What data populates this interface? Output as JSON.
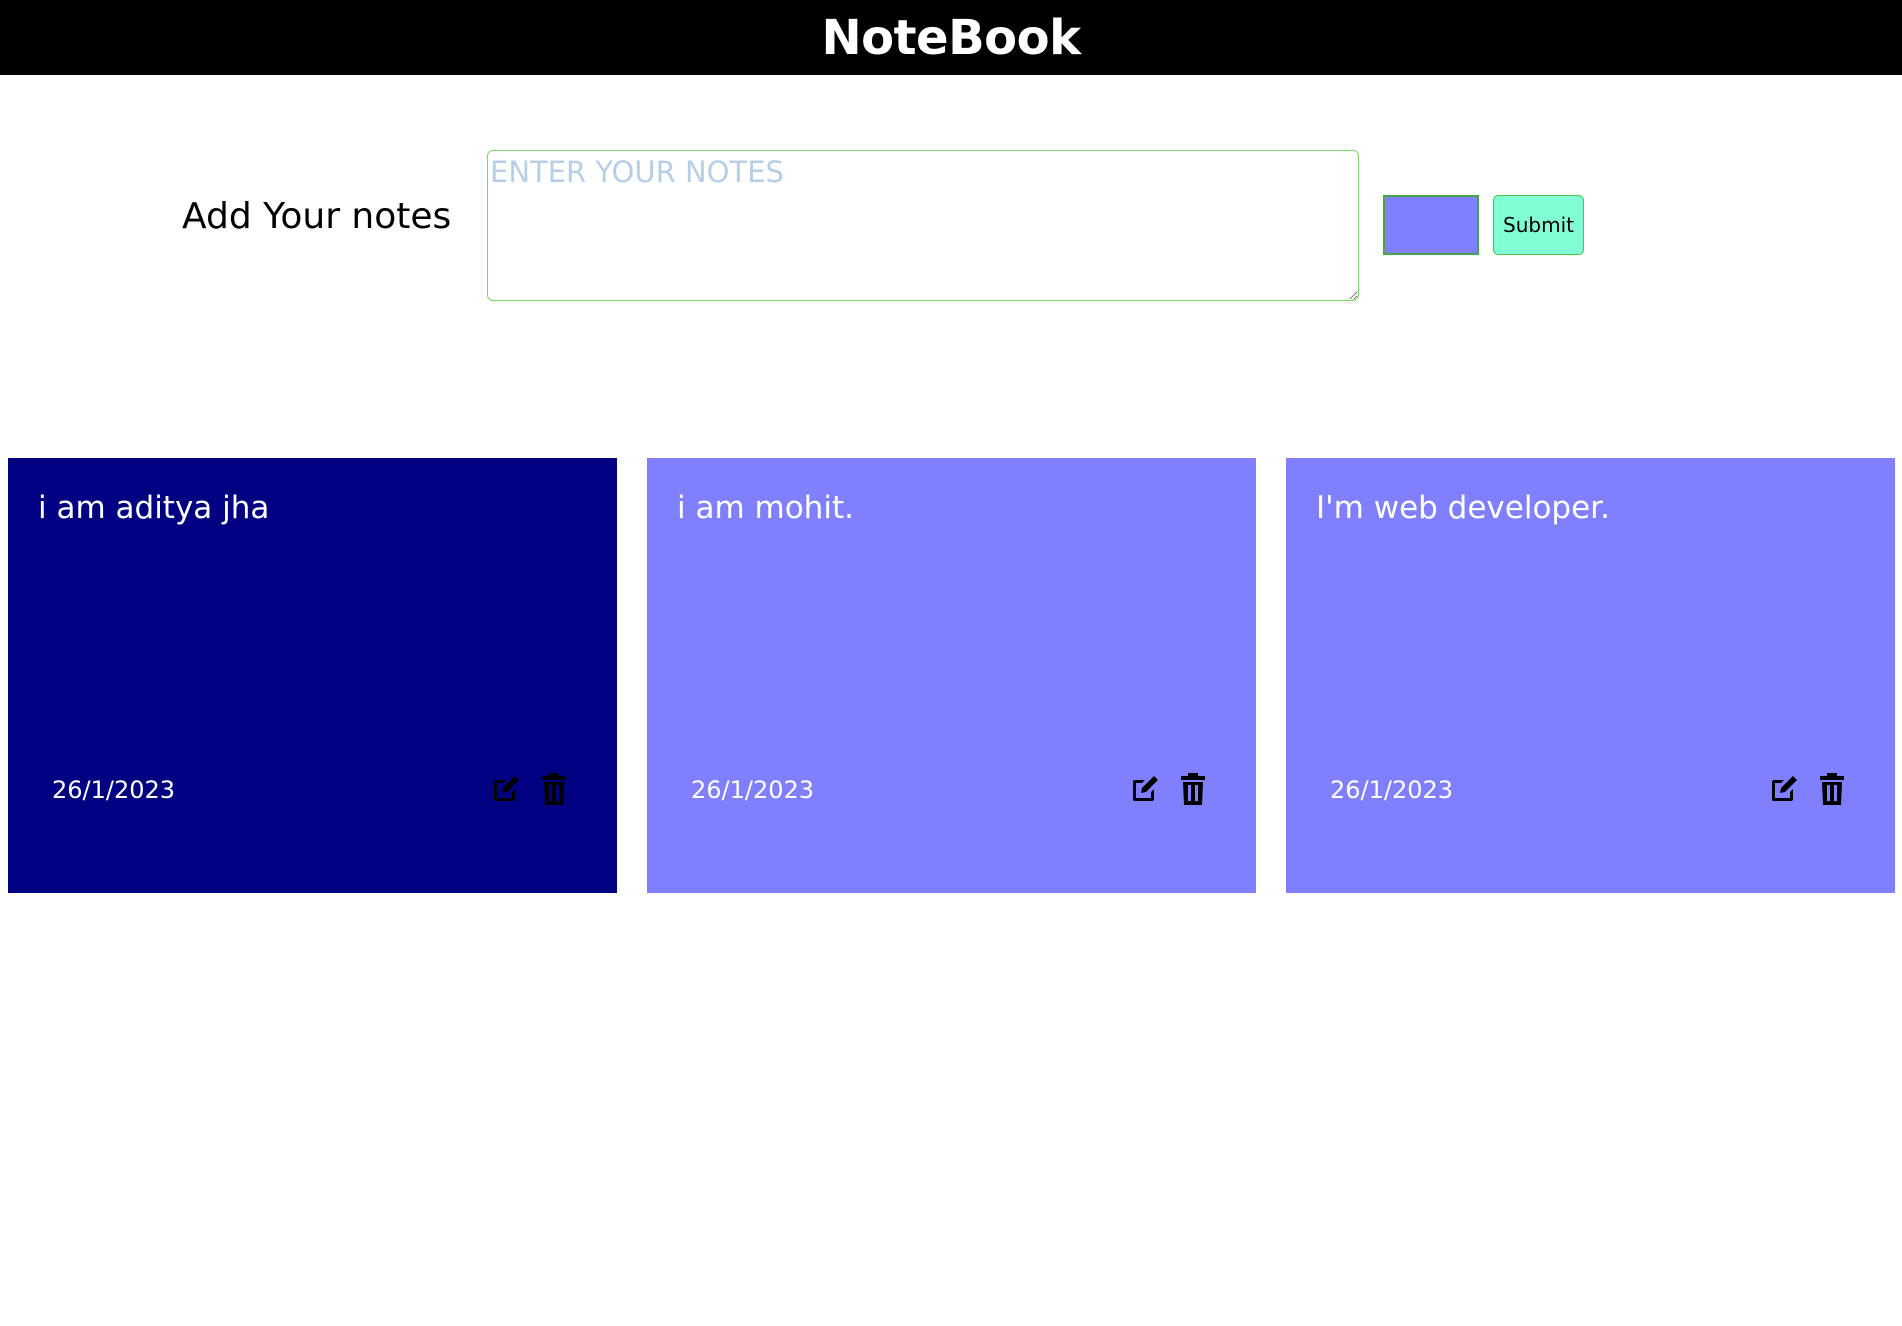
{
  "header": {
    "title": "NoteBook"
  },
  "form": {
    "label": "Add Your notes",
    "notes_placeholder": "ENTER YOUR NOTES",
    "notes_value": "",
    "selected_color": "#8080ff",
    "submit_label": "Submit"
  },
  "notes": [
    {
      "text": "i am aditya jha",
      "date": "26/1/2023",
      "color": "#000080",
      "edit_icon": "edit-icon",
      "delete_icon": "trash-icon"
    },
    {
      "text": "i am mohit.",
      "date": "26/1/2023",
      "color": "#8080ff",
      "edit_icon": "edit-icon",
      "delete_icon": "trash-icon"
    },
    {
      "text": "I'm web developer.",
      "date": "26/1/2023",
      "color": "#8080ff",
      "edit_icon": "edit-icon",
      "delete_icon": "trash-icon"
    }
  ],
  "colors": {
    "header_bg": "#000000",
    "submit_bg": "#80ffd4",
    "input_border": "#7fd36a"
  }
}
